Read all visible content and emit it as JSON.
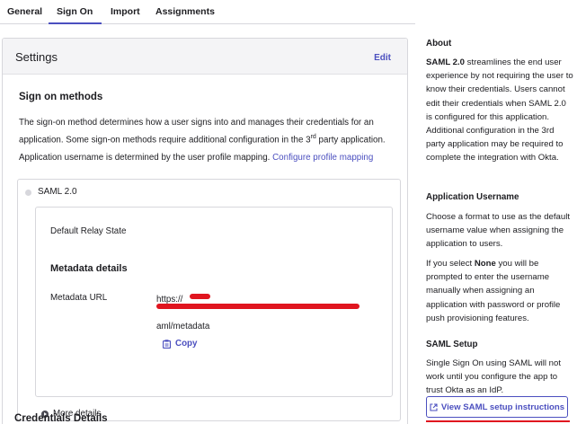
{
  "tabs": [
    {
      "label": "General"
    },
    {
      "label": "Sign On"
    },
    {
      "label": "Import"
    },
    {
      "label": "Assignments"
    }
  ],
  "settings": {
    "title": "Settings",
    "edit_label": "Edit",
    "sign_on_methods_title": "Sign on methods",
    "description_part1": "The sign-on method determines how a user signs into and manages their credentials for an application. Some sign-on methods require additional configuration in the 3",
    "description_sup": "rd",
    "description_part2": " party application.",
    "username_text": "Application username is determined by the user profile mapping.",
    "configure_link": "Configure profile mapping",
    "saml_label": "SAML 2.0",
    "relay_state_label": "Default Relay State",
    "metadata_title": "Metadata details",
    "metadata_url_label": "Metadata URL",
    "metadata_url_prefix": "https://",
    "metadata_url_suffix": "aml/metadata",
    "copy_label": "Copy",
    "more_details_label": "More details",
    "credentials_title": "Credentials Details"
  },
  "aside": {
    "about_title": "About",
    "about_bold": "SAML 2.0",
    "about_text": " streamlines the end user experience by not requiring the user to know their credentials. Users cannot edit their credentials when SAML 2.0 is configured for this application. Additional configuration in the 3rd party application may be required to complete the integration with Okta.",
    "username_title": "Application Username",
    "username_text": "Choose a format to use as the default username value when assigning the application to users.",
    "none_prefix": "If you select ",
    "none_bold": "None",
    "none_text": " you will be prompted to enter the username manually when assigning an application with password or profile push provisioning features.",
    "saml_setup_title": "SAML Setup",
    "saml_setup_text": "Single Sign On using SAML will not work until you configure the app to trust Okta as an IdP.",
    "setup_button_label": "View SAML setup instructions"
  },
  "colors": {
    "accent": "#4b4fbf",
    "redaction": "#e0151f",
    "border": "#d7d7dc"
  }
}
